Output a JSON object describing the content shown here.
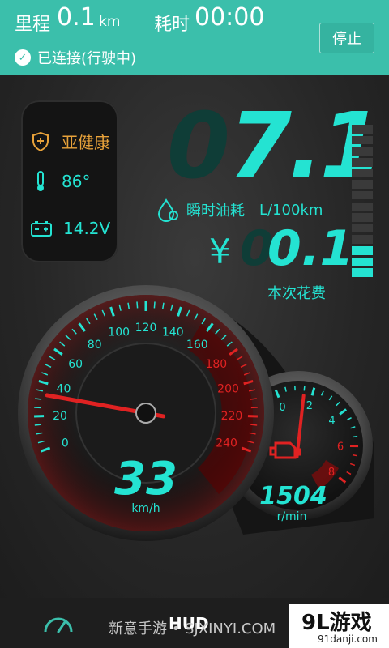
{
  "header": {
    "mileage_label": "里程",
    "mileage_value": "0.1",
    "mileage_unit": "km",
    "time_label": "耗时",
    "time_value": "00:00",
    "status": "已连接(行驶中)",
    "stop_button": "停止"
  },
  "status_panel": {
    "health": "亚健康",
    "temperature": "86°",
    "voltage": "14.2V"
  },
  "fuel": {
    "instant_ghost": "0",
    "instant_value": "7.1",
    "label": "瞬时油耗",
    "unit": "L/100km",
    "currency": "¥",
    "cost_ghost": "0",
    "cost_value": "0.1",
    "cost_label": "本次花费",
    "fuel_level": 0.2
  },
  "speedometer": {
    "ticks": [
      "0",
      "20",
      "40",
      "60",
      "80",
      "100",
      "120",
      "140",
      "160",
      "180",
      "200",
      "220",
      "240"
    ],
    "value": 33,
    "display": "33",
    "unit": "km/h",
    "max": 240
  },
  "tachometer": {
    "ticks": [
      "0",
      "2",
      "4",
      "6",
      "8"
    ],
    "value_krpm": 1.504,
    "display": "1504",
    "unit": "r/min"
  },
  "watermark": {
    "text": "新意手游 • SJXINYI.COM",
    "hud": "HUD",
    "logo_main": "9L游戏",
    "logo_sub": "91danji.com"
  },
  "colors": {
    "teal": "#3bbfab",
    "cyan": "#24e3d2",
    "orange": "#e8a23a",
    "red": "#e02222"
  },
  "icons": [
    "check-icon",
    "shield-icon",
    "thermometer-icon",
    "battery-icon",
    "drop-icon",
    "gauge-icon",
    "engine-icon"
  ]
}
